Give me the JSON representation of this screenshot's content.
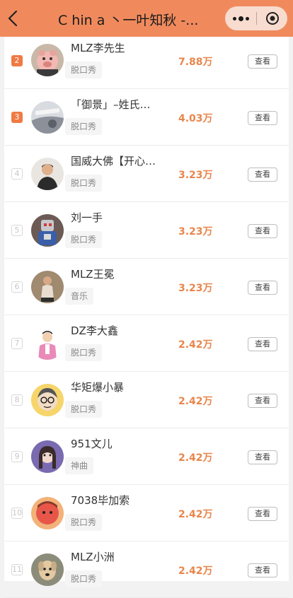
{
  "header": {
    "title": "C hin a 丶一叶知秋 -...",
    "back_icon": "back-arrow-icon",
    "more_icon": "more-dots-icon",
    "close_icon": "target-close-icon",
    "background": "#f08a5d"
  },
  "list": {
    "accent_color": "#e8864c",
    "view_label": "查看",
    "items": [
      {
        "rank": "2",
        "name": "MLZ李先生",
        "tag": "脱口秀",
        "value": "7.88万",
        "avatar": "pig-avatar"
      },
      {
        "rank": "3",
        "name": "「御景」–姓氏…",
        "tag": "脱口秀",
        "value": "4.03万",
        "avatar": "gray-avatar"
      },
      {
        "rank": "4",
        "name": "国威大佛【开心…",
        "tag": "脱口秀",
        "value": "3.23万",
        "avatar": "man-avatar"
      },
      {
        "rank": "5",
        "name": "刘一手",
        "tag": "脱口秀",
        "value": "3.23万",
        "avatar": "robot-avatar"
      },
      {
        "rank": "6",
        "name": "MLZ王冕",
        "tag": "音乐",
        "value": "3.23万",
        "avatar": "sitting-man-avatar"
      },
      {
        "rank": "7",
        "name": "DZ李大鑫",
        "tag": "脱口秀",
        "value": "2.42万",
        "avatar": "cartoon-boy-avatar"
      },
      {
        "rank": "8",
        "name": "华矩爆小暴",
        "tag": "脱口秀",
        "value": "2.42万",
        "avatar": "glasses-cartoon-avatar"
      },
      {
        "rank": "9",
        "name": "951文儿",
        "tag": "神曲",
        "value": "2.42万",
        "avatar": "girl-avatar"
      },
      {
        "rank": "10",
        "name": "7038毕加索",
        "tag": "脱口秀",
        "value": "2.42万",
        "avatar": "red-face-avatar"
      },
      {
        "rank": "11",
        "name": "MLZ小洲",
        "tag": "脱口秀",
        "value": "2.42万",
        "avatar": "dog-avatar"
      }
    ]
  }
}
